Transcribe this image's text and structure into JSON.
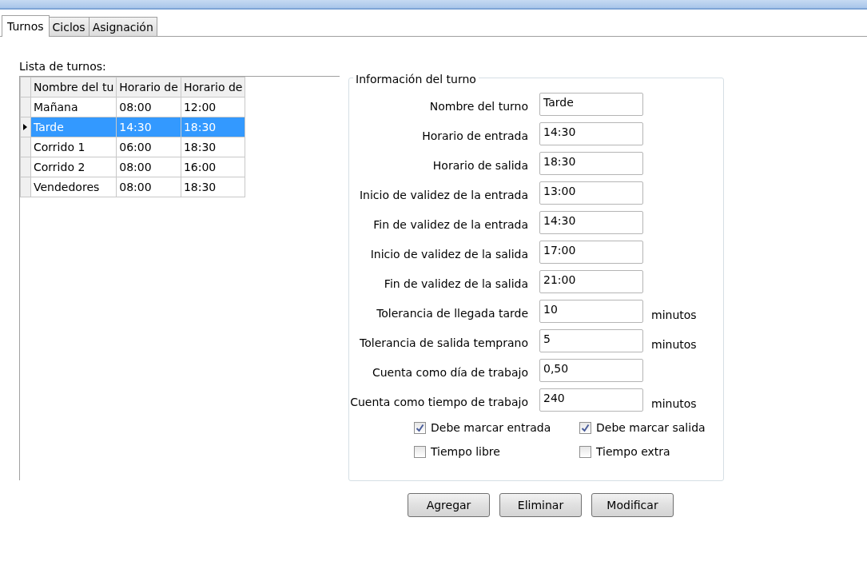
{
  "tabs": [
    {
      "label": "Turnos",
      "selected": true
    },
    {
      "label": "Ciclos",
      "selected": false
    },
    {
      "label": "Asignación",
      "selected": false
    }
  ],
  "shift_list": {
    "label": "Lista de turnos:",
    "columns": [
      "Nombre del tu",
      "Horario de",
      "Horario de"
    ],
    "rows": [
      {
        "cells": [
          "Mañana",
          "08:00",
          "12:00"
        ],
        "selected": false
      },
      {
        "cells": [
          "Tarde",
          "14:30",
          "18:30"
        ],
        "selected": true
      },
      {
        "cells": [
          "Corrido 1",
          "06:00",
          "18:30"
        ],
        "selected": false
      },
      {
        "cells": [
          "Corrido 2",
          "08:00",
          "16:00"
        ],
        "selected": false
      },
      {
        "cells": [
          "Vendedores",
          "08:00",
          "18:30"
        ],
        "selected": false
      }
    ]
  },
  "shift_info": {
    "legend": "Información del turno",
    "fields": [
      {
        "label": "Nombre del turno",
        "value": "Tarde"
      },
      {
        "label": "Horario de entrada",
        "value": "14:30"
      },
      {
        "label": "Horario de salida",
        "value": "18:30"
      },
      {
        "label": "Inicio de validez de la entrada",
        "value": "13:00"
      },
      {
        "label": "Fin de validez de la entrada",
        "value": "14:30"
      },
      {
        "label": "Inicio de validez de la salida",
        "value": "17:00"
      },
      {
        "label": "Fin de validez de la salida",
        "value": "21:00"
      },
      {
        "label": "Tolerancia de llegada tarde",
        "value": "10",
        "unit": "minutos"
      },
      {
        "label": "Tolerancia de salida temprano",
        "value": "5",
        "unit": "minutos"
      },
      {
        "label": "Cuenta como día de trabajo",
        "value": "0,50"
      },
      {
        "label": "Cuenta como tiempo de trabajo",
        "value": "240",
        "unit": "minutos"
      }
    ],
    "checkboxes": [
      {
        "label": "Debe marcar entrada",
        "checked": true
      },
      {
        "label": "Debe marcar salida",
        "checked": true
      },
      {
        "label": "Tiempo libre",
        "checked": false
      },
      {
        "label": "Tiempo extra",
        "checked": false
      }
    ]
  },
  "buttons": [
    "Agregar",
    "Eliminar",
    "Modificar"
  ]
}
